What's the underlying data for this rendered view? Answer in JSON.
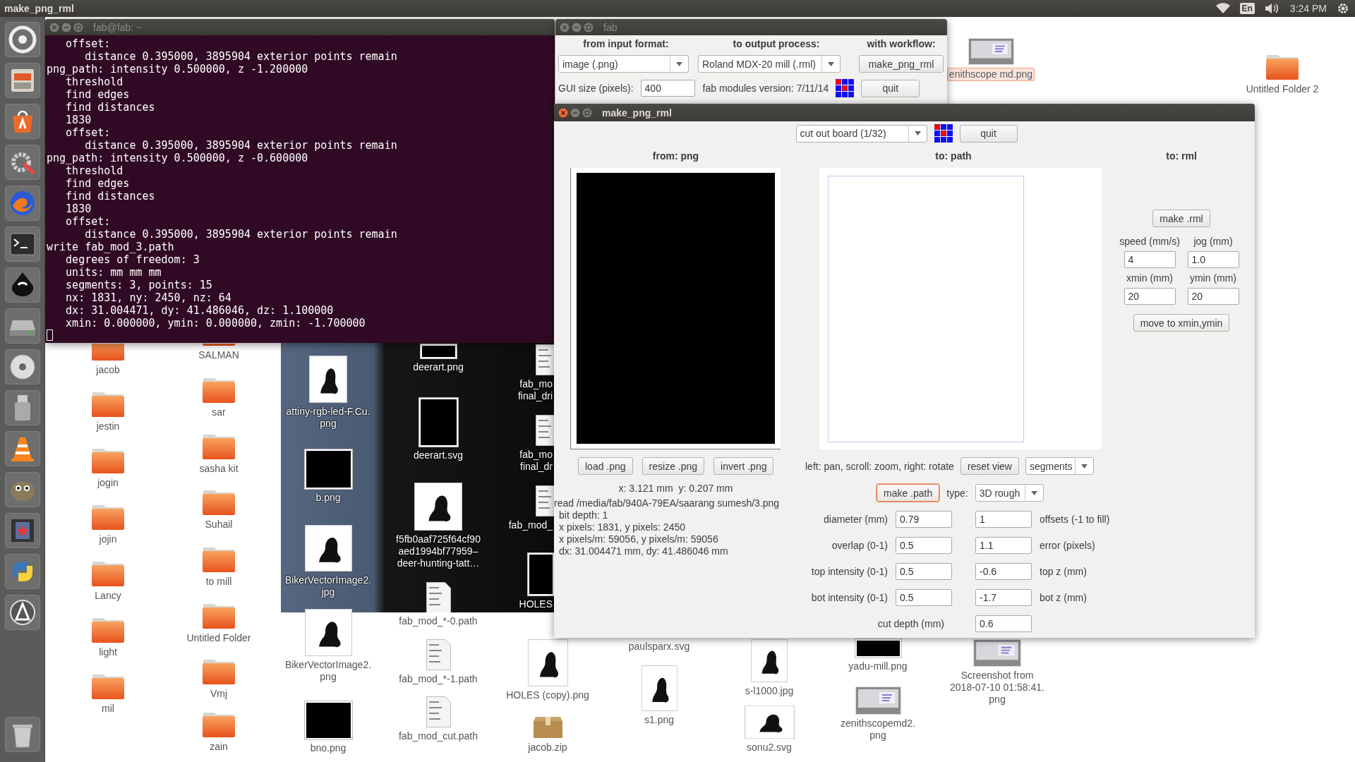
{
  "top_panel": {
    "title": "make_png_rml",
    "keyboard": "En",
    "clock": "3:24 PM"
  },
  "terminal": {
    "title": "fab@fab: ~",
    "active": false,
    "lines": [
      "   offset:",
      "      distance 0.395000, 3895904 exterior points remain",
      "png_path: intensity 0.500000, z -1.200000",
      "   threshold",
      "   find edges",
      "   find distances",
      "   1830",
      "   offset:",
      "      distance 0.395000, 3895904 exterior points remain",
      "png_path: intensity 0.500000, z -0.600000",
      "   threshold",
      "   find edges",
      "   find distances",
      "   1830",
      "   offset:",
      "      distance 0.395000, 3895904 exterior points remain",
      "write fab_mod_3.path",
      "   degrees of freedom: 3",
      "   units: mm mm mm",
      "   segments: 3, points: 15",
      "   nx: 1831, ny: 2450, nz: 64",
      "   dx: 31.004471, dy: 41.486046, dz: 1.100000",
      "   xmin: 0.000000, ymin: 0.000000, zmin: -1.700000"
    ]
  },
  "fab_window": {
    "title": "fab",
    "active": false,
    "headings": [
      "from input format:",
      "to output process:",
      "with workflow:"
    ],
    "input_format": "image (.png)",
    "output_process": "Roland MDX-20 mill (.rml)",
    "workflow_button": "make_png_rml",
    "gui_size_label": "GUI size (pixels):",
    "gui_size": "400",
    "version": "fab modules version: 7/11/14",
    "quit": "quit"
  },
  "rml_window": {
    "title": "make_png_rml",
    "active": true,
    "process": "cut out board (1/32)",
    "quit": "quit",
    "columns": [
      "from: png",
      "to: path",
      "to: rml"
    ],
    "png_buttons": [
      "load .png",
      "resize .png",
      "invert .png"
    ],
    "cursor_position": "x: 3.121 mm  y: 0.207 mm",
    "info_lines": [
      "read /media/fab/940A-79EA/saarang sumesh/3.png",
      "bit depth: 1",
      "x pixels: 1831, y pixels: 2450",
      "x pixels/m: 59056, y pixels/m: 59056",
      "dx: 31.004471 mm, dy: 41.486046 mm"
    ],
    "view_hint": "left: pan, scroll: zoom, right: rotate",
    "reset_view": "reset view",
    "display_mode": "segments",
    "make_path": {
      "label": "make .path",
      "focused": true
    },
    "type_label": "type:",
    "path_type": "3D rough",
    "params": [
      {
        "label": "diameter (mm)",
        "value": "0.79",
        "value_2": "1",
        "label_2": "offsets (-1 to fill)"
      },
      {
        "label": "overlap (0-1)",
        "value": "0.5",
        "value_2": "1.1",
        "label_2": "error (pixels)"
      },
      {
        "label": "top intensity (0-1)",
        "value": "0.5",
        "value_2": "-0.6",
        "label_2": "top z (mm)"
      },
      {
        "label": "bot intensity (0-1)",
        "value": "0.5",
        "value_2": "-1.7",
        "label_2": "bot z (mm)"
      }
    ],
    "cut_depth": {
      "label": "cut depth (mm)",
      "value": "0.6"
    },
    "rml": {
      "make_button": "make .rml",
      "fields": [
        {
          "label": "speed (mm/s)",
          "value": "4"
        },
        {
          "label": "jog (mm)",
          "value": "1.0"
        },
        {
          "label": "xmin (mm)",
          "value": "20"
        },
        {
          "label": "ymin (mm)",
          "value": "20"
        }
      ],
      "move_button": "move to xmin,ymin"
    }
  },
  "desktop_icons": [
    {
      "kind": "folder",
      "label_lines": [
        "jacob"
      ],
      "selected": false
    },
    {
      "kind": "folder",
      "label_lines": [
        "jestin"
      ],
      "selected": false
    },
    {
      "kind": "folder",
      "label_lines": [
        "jogin"
      ],
      "selected": false
    },
    {
      "kind": "folder",
      "label_lines": [
        "jojin"
      ],
      "selected": false
    },
    {
      "kind": "folder",
      "label_lines": [
        "Lancy"
      ],
      "selected": false
    },
    {
      "kind": "folder",
      "label_lines": [
        "light"
      ],
      "selected": false
    },
    {
      "kind": "folder",
      "label_lines": [
        "mil"
      ],
      "selected": false
    },
    {
      "kind": "folder",
      "label_lines": [
        "SALMAN"
      ],
      "selected": false
    },
    {
      "kind": "folder",
      "label_lines": [
        "sar"
      ],
      "selected": false
    },
    {
      "kind": "folder",
      "label_lines": [
        "sasha kit"
      ],
      "selected": false
    },
    {
      "kind": "folder",
      "label_lines": [
        "Suhail"
      ],
      "selected": false
    },
    {
      "kind": "folder",
      "label_lines": [
        "to mill"
      ],
      "selected": false
    },
    {
      "kind": "folder",
      "label_lines": [
        "Untitled Folder"
      ],
      "selected": false
    },
    {
      "kind": "folder",
      "label_lines": [
        "Vmj"
      ],
      "selected": false
    },
    {
      "kind": "folder",
      "label_lines": [
        "zain"
      ],
      "selected": false
    },
    {
      "kind": "light-image",
      "label_lines": [
        "attiny-rgb-led-F.Cu.",
        "png"
      ],
      "selected": false
    },
    {
      "kind": "dark-image",
      "label_lines": [
        "b.png"
      ],
      "selected": false
    },
    {
      "kind": "light-image",
      "label_lines": [
        "BikerVectorImage2.",
        "jpg"
      ],
      "selected": false
    },
    {
      "kind": "light-image",
      "label_lines": [
        "BikerVectorImage2.",
        "png"
      ],
      "selected": false
    },
    {
      "kind": "dark-image",
      "label_lines": [
        "bno.png"
      ],
      "selected": false
    },
    {
      "kind": "dark-image",
      "label_lines": [
        "deerart.png"
      ],
      "selected": false
    },
    {
      "kind": "dark-image",
      "label_lines": [
        "deerart.svg"
      ],
      "selected": false
    },
    {
      "kind": "light-image",
      "label_lines": [
        "f5fb0aaf725f64cf90",
        "aed1994bf77959–",
        "deer-hunting-tatt…"
      ],
      "selected": false
    },
    {
      "kind": "document",
      "label_lines": [
        "fab_mod_*-0.path"
      ],
      "selected": false
    },
    {
      "kind": "document",
      "label_lines": [
        "fab_mod_*-1.path"
      ],
      "selected": false
    },
    {
      "kind": "document",
      "label_lines": [
        "fab_mod_cut.path"
      ],
      "selected": false
    },
    {
      "kind": "document",
      "label_lines": [
        "fab_mo",
        "final_dri"
      ],
      "selected": false
    },
    {
      "kind": "document",
      "label_lines": [
        "fab_mo",
        "final_dr"
      ],
      "selected": false
    },
    {
      "kind": "document",
      "label_lines": [
        "fab_mod_"
      ],
      "selected": false
    },
    {
      "kind": "dark-image",
      "label_lines": [
        "HOLES"
      ],
      "selected": false
    },
    {
      "kind": "light-image",
      "label_lines": [
        "HOLES (copy).png"
      ],
      "selected": false
    },
    {
      "kind": "archive",
      "label_lines": [
        "jacob.zip"
      ],
      "selected": false
    },
    {
      "kind": "covered",
      "label_lines": [
        "paulsparx.svg"
      ],
      "selected": false
    },
    {
      "kind": "light-image",
      "label_lines": [
        "s1.png"
      ],
      "selected": false
    },
    {
      "kind": "light-image",
      "label_lines": [
        "s-l1000.jpg"
      ],
      "selected": false
    },
    {
      "kind": "light-image",
      "label_lines": [
        "sonu2.svg"
      ],
      "selected": false
    },
    {
      "kind": "dark-image",
      "label_lines": [
        "yadu-mill.png"
      ],
      "selected": false
    },
    {
      "kind": "screenshot",
      "label_lines": [
        "zenithscopemd2.",
        "png"
      ],
      "selected": false
    },
    {
      "kind": "screenshot",
      "label_lines": [
        "enithscope md.png"
      ],
      "selected": true
    },
    {
      "kind": "screenshot",
      "label_lines": [
        "Screenshot from",
        "2018-07-10 01:58:41.",
        "png"
      ],
      "selected": false
    },
    {
      "kind": "folder",
      "label_lines": [
        "Untitled Folder 2"
      ],
      "selected": false
    }
  ]
}
